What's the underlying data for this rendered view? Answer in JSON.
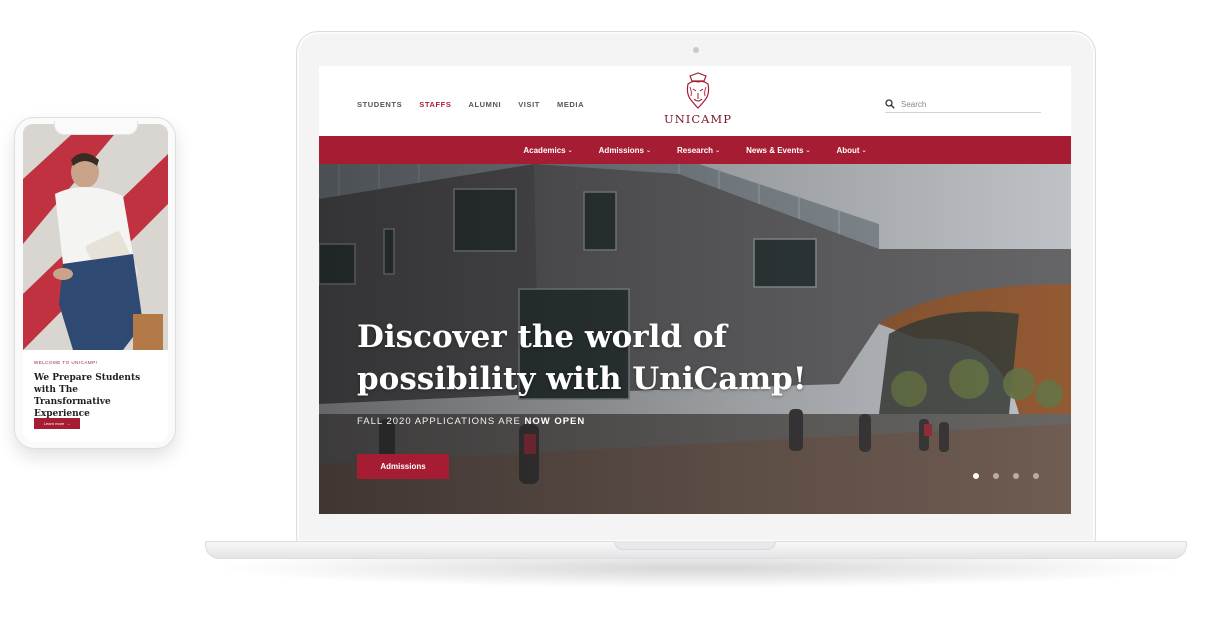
{
  "header": {
    "top_links": [
      {
        "label": "STUDENTS"
      },
      {
        "label": "STAFFS"
      },
      {
        "label": "ALUMNI"
      },
      {
        "label": "VISIT"
      },
      {
        "label": "MEDIA"
      }
    ],
    "active_top_link": "STAFFS",
    "logo_text": "UNICAMP",
    "search_placeholder": "Search"
  },
  "main_nav": [
    {
      "label": "Academics"
    },
    {
      "label": "Admissions"
    },
    {
      "label": "Research"
    },
    {
      "label": "News & Events"
    },
    {
      "label": "About"
    }
  ],
  "hero": {
    "title_line1": "Discover the world of",
    "title_line2": "possibility with UniCamp!",
    "subtitle_prefix": "FALL 2020 APPLICATIONS ARE ",
    "subtitle_emphasis": "NOW OPEN",
    "button_label": "Admissions",
    "slide_count": 4,
    "active_slide": 1
  },
  "mobile": {
    "eyebrow": "WELCOME TO UNICAMP!",
    "title": "We Prepare Students with The Transformative Experience",
    "button_label": "Learn more",
    "button_arrow": "→"
  },
  "colors": {
    "brand": "#a61d33",
    "logo": "#7d1527"
  },
  "icons": {
    "search": "search-icon",
    "dropdown": "chevron-down-icon",
    "logo": "lion-crest-icon"
  }
}
